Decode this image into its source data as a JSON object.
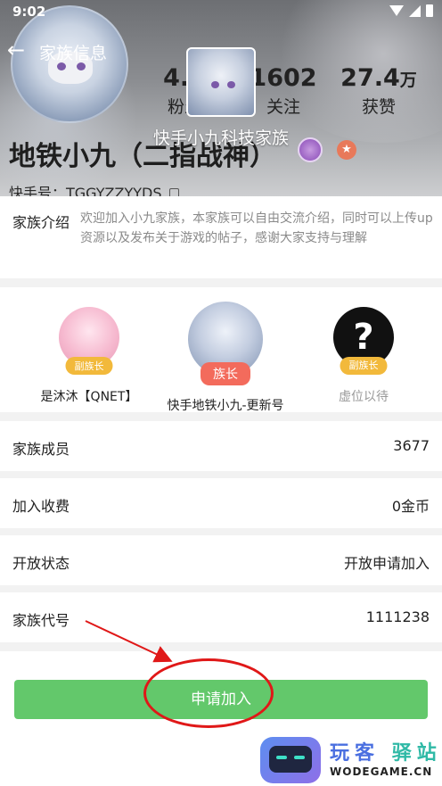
{
  "status_bar": {
    "time": "9:02"
  },
  "header": {
    "back_icon": "arrow-left-icon",
    "title": "家族信息"
  },
  "profile": {
    "stats": [
      {
        "value": "4.6",
        "label": "粉丝"
      },
      {
        "value": "1602",
        "label": "关注"
      },
      {
        "value": "27.4",
        "unit": "万",
        "label": "获赞"
      }
    ],
    "family_name": "快手小九科技家族",
    "user_name": "地铁小九（二指战神）",
    "ks_id": "快手号：TGGYZZYYDS"
  },
  "intro": {
    "label": "家族介绍",
    "text": "欢迎加入小九家族，本家族可以自由交流介绍，同时可以上传up资源以及发布关于游戏的帖子，感谢大家支持与理解"
  },
  "leaders": [
    {
      "role": "副族长",
      "name": "是沐沐【QNET】",
      "role_color": "#f2b93b"
    },
    {
      "role": "族长",
      "name": "快手地铁小九-更新号",
      "role_color": "#f36b5c"
    },
    {
      "role": "副族长",
      "name": "虚位以待",
      "role_color": "#f2b93b"
    }
  ],
  "rows": [
    {
      "label": "家族成员",
      "value": "3677"
    },
    {
      "label": "加入收费",
      "value": "0金币"
    },
    {
      "label": "开放状态",
      "value": "开放申请加入"
    },
    {
      "label": "家族代号",
      "value": "1111238"
    }
  ],
  "apply_button": "申请加入",
  "watermark": {
    "title_a": "玩客",
    "title_b": "驿站",
    "sub": "WODEGAME.CN"
  },
  "colors": {
    "primary": "#63c86b",
    "annotation": "#e01818"
  }
}
